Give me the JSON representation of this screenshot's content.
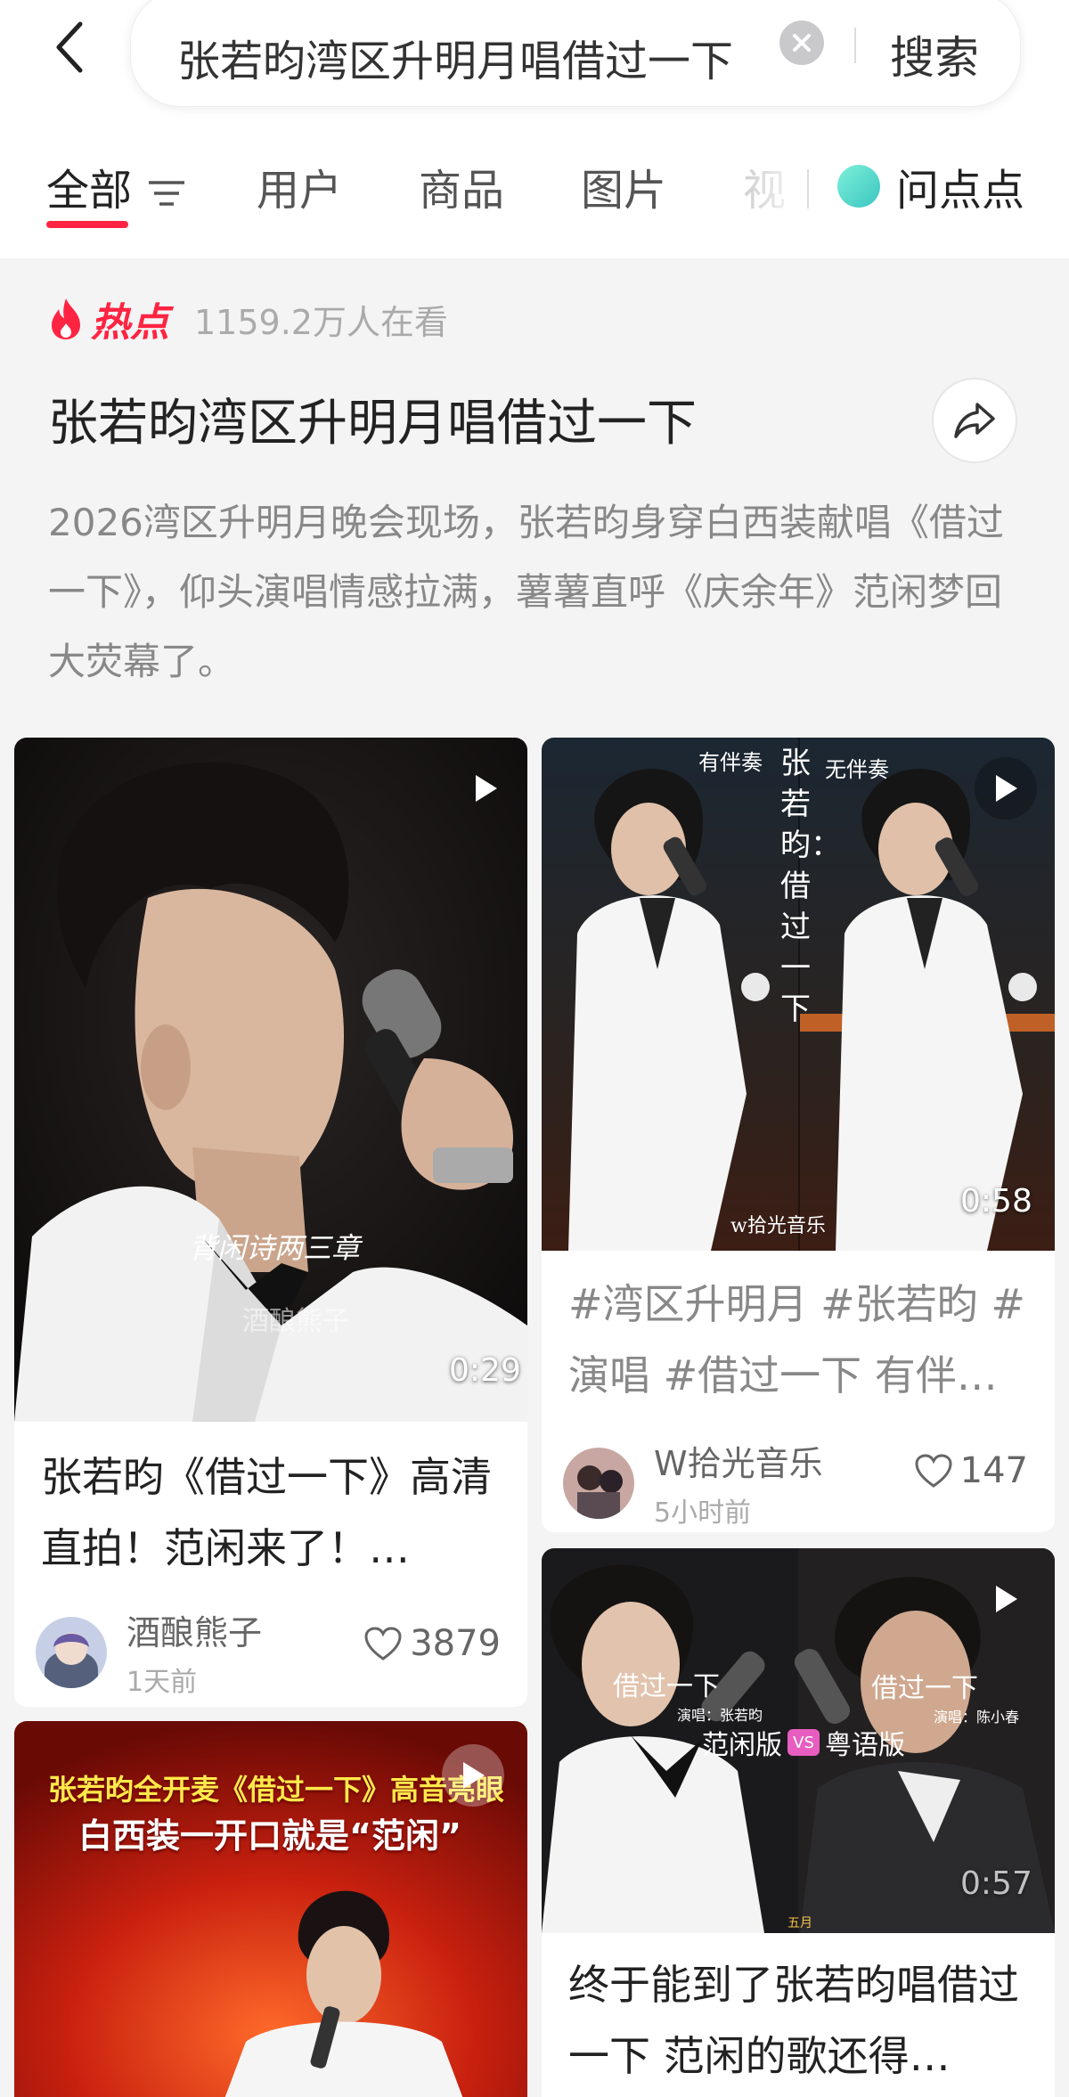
{
  "search": {
    "query": "张若昀湾区升明月唱借过一下",
    "button_label": "搜索"
  },
  "tabs": [
    {
      "label": "全部"
    },
    {
      "label": "用户"
    },
    {
      "label": "商品"
    },
    {
      "label": "图片"
    },
    {
      "label": "视"
    }
  ],
  "wendian": {
    "label": "问点点"
  },
  "hot": {
    "badge": "热点",
    "viewers": "1159.2万人在看",
    "title": "张若昀湾区升明月唱借过一下",
    "description": "2026湾区升明月晚会现场，张若昀身穿白西装献唱《借过一下》，仰头演唱情感拉满，薯薯直呼《庆余年》范闲梦回大荧幕了。"
  },
  "cards": [
    {
      "title": "张若昀《借过一下》高清直拍！范闲来了！…",
      "author": "酒酿熊子",
      "time": "1天前",
      "likes": "3879",
      "duration": "0:29",
      "caption": "背闲诗两三章",
      "watermark": "酒酿熊子"
    },
    {
      "title": "#湾区升明月 #张若昀 #演唱 #借过一下 有伴…",
      "author": "W拾光音乐",
      "time": "5小时前",
      "likes": "147",
      "duration": "0:58",
      "label_left": "有伴奏",
      "label_right": "无伴奏",
      "vertical_caption": "张若昀：借过一下",
      "watermark": "w拾光音乐"
    },
    {
      "title": "终于能到了张若昀唱借过一下 范闲的歌还得…",
      "duration": "0:57",
      "left_song": "借过一下",
      "left_singer": "演唱：张若昀",
      "right_song": "借过一下",
      "right_singer": "演唱：陈小春",
      "versus_left": "范闲版",
      "versus_mid": "VS",
      "versus_right": "粤语版",
      "corner": "五月"
    },
    {
      "headline_1": "张若昀全开麦《借过一下》高音亮眼",
      "headline_2": "白西装一开口就是“范闲”"
    }
  ],
  "colors": {
    "accent": "#ff2442",
    "background": "#f4f4f5"
  }
}
